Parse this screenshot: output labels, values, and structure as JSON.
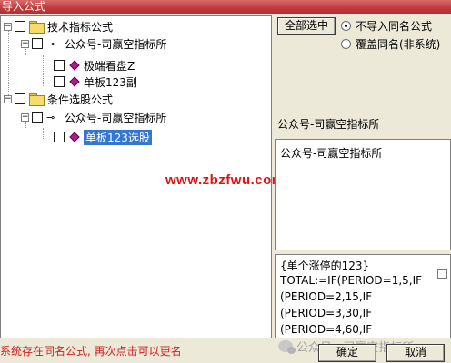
{
  "window": {
    "title": "导入公式"
  },
  "tree": {
    "nodes": [
      {
        "label": "技术指标公式"
      },
      {
        "label": "公众号-司赢空指标所"
      },
      {
        "label": "极端看盘Z"
      },
      {
        "label": "单板123副"
      },
      {
        "label": "条件选股公式"
      },
      {
        "label": "公众号-司赢空指标所"
      },
      {
        "label": "单板123选股"
      }
    ],
    "expander_symbol": "−"
  },
  "overlay_watermark": "www.zbzfwu.com",
  "options": {
    "select_all_label": "全部选中",
    "radio_no_import": "不导入同名公式",
    "radio_overwrite": "覆盖同名(非系统)",
    "selected_radio": "no_import"
  },
  "info": {
    "name": "公众号-司赢空指标所",
    "description": "公众号-司赢空指标所"
  },
  "code": {
    "lines": [
      "{单个涨停的123}",
      "TOTAL:=IF(PERIOD=1,5,IF",
      "(PERIOD=2,15,IF",
      "(PERIOD=3,30,IF",
      "(PERIOD=4,60,IF"
    ]
  },
  "status_message": "系统存在同名公式, 再次点击可以更名",
  "buttons": {
    "ok": "确定",
    "cancel": "取消"
  },
  "wechat_watermark": "公众号 · 司赢空指标所",
  "colors": {
    "titlebar": "#c0393b",
    "selection": "#3377d2",
    "status_text": "#d21e1e",
    "watermark": "#e11212"
  }
}
